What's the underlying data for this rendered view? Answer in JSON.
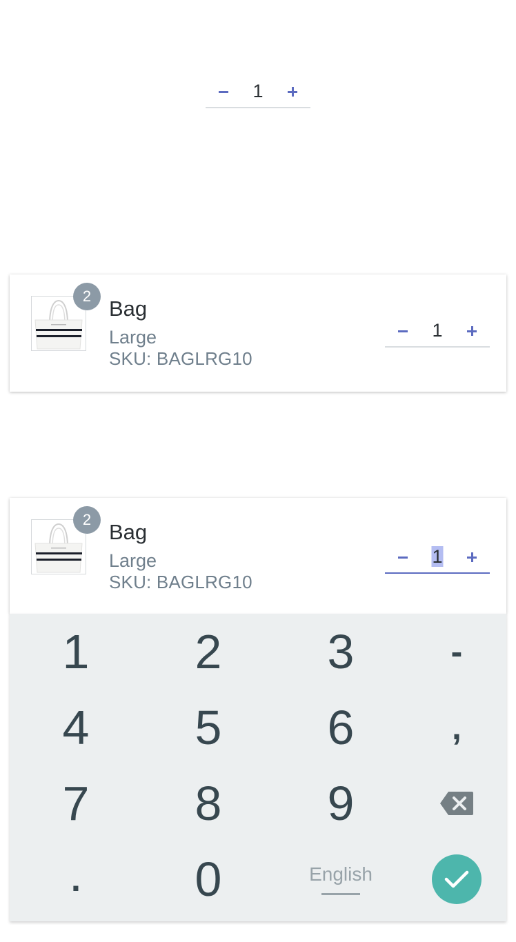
{
  "top_stepper": {
    "minus_icon": "minus-icon",
    "value": "1",
    "plus_icon": "plus-icon"
  },
  "cards": [
    {
      "badge": "2",
      "name": "Bag",
      "variant": "Large",
      "sku": "SKU: BAGLRG10",
      "quantity": "1"
    },
    {
      "badge": "2",
      "name": "Bag",
      "variant": "Large",
      "sku": "SKU: BAGLRG10",
      "quantity": "1"
    }
  ],
  "keypad": {
    "keys": [
      "1",
      "2",
      "3",
      "-",
      "4",
      "5",
      "6",
      ",",
      "7",
      "8",
      "9",
      "backspace-icon",
      ".",
      "0",
      "English",
      "check-icon"
    ],
    "language": "English"
  },
  "colors": {
    "accent": "#5c6bc0",
    "selection": "#b4bdf2",
    "badge": "#8c9aa6",
    "keypad_bg": "#eceff0",
    "enter": "#4db6ac"
  }
}
